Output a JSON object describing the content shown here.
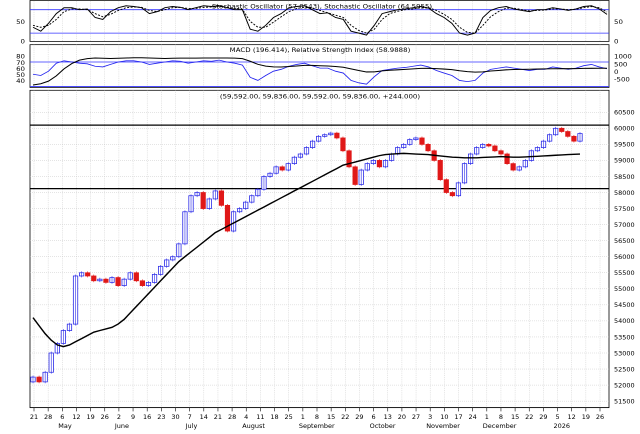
{
  "chart_data": [
    {
      "type": "line",
      "panel": "stochastic",
      "title": "Stochastic Oscillator (57.0543), Stochastic Oscillator (64.5955)",
      "ylim": [
        0,
        100
      ],
      "yticks": [
        0,
        50,
        100
      ],
      "ref_lines": [
        20,
        80
      ],
      "series": [
        {
          "name": "Stochastic %K",
          "values": [
            35,
            25,
            45,
            70,
            85,
            85,
            80,
            82,
            60,
            55,
            75,
            85,
            90,
            88,
            85,
            70,
            75,
            85,
            88,
            86,
            80,
            85,
            90,
            88,
            90,
            85,
            80,
            80,
            30,
            25,
            40,
            60,
            70,
            85,
            88,
            90,
            80,
            70,
            72,
            60,
            55,
            25,
            20,
            15,
            40,
            70,
            75,
            80,
            82,
            85,
            88,
            84,
            70,
            60,
            45,
            20,
            15,
            20,
            60,
            78,
            85,
            88,
            82,
            78,
            75,
            80,
            80,
            85,
            82,
            78,
            82,
            88,
            90,
            82,
            68
          ]
        },
        {
          "name": "Stochastic %D",
          "values": [
            40,
            35,
            40,
            55,
            75,
            82,
            82,
            80,
            70,
            62,
            68,
            78,
            85,
            87,
            86,
            78,
            75,
            80,
            85,
            86,
            83,
            83,
            86,
            87,
            88,
            87,
            83,
            81,
            50,
            35,
            35,
            48,
            62,
            75,
            83,
            86,
            84,
            78,
            72,
            66,
            60,
            40,
            27,
            20,
            30,
            55,
            70,
            76,
            80,
            82,
            85,
            85,
            78,
            68,
            55,
            35,
            22,
            20,
            40,
            62,
            75,
            84,
            84,
            80,
            77,
            78,
            79,
            82,
            82,
            80,
            81,
            85,
            88,
            85,
            74
          ]
        }
      ]
    },
    {
      "type": "line",
      "panel": "macd_rsi",
      "title": "MACD (196.414), Relative Strength Index (58.9888)",
      "ylim_left": [
        30,
        80
      ],
      "yticks_left": [
        40,
        50,
        60,
        70,
        80
      ],
      "ylim_right": [
        -1000,
        1000
      ],
      "yticks_right": [
        -500,
        0,
        500,
        1000
      ],
      "ref_lines_left": [
        30,
        70
      ],
      "series": [
        {
          "name": "RSI",
          "values": [
            50,
            48,
            55,
            68,
            72,
            70,
            68,
            67,
            63,
            62,
            66,
            70,
            72,
            72,
            70,
            66,
            68,
            70,
            72,
            71,
            68,
            70,
            72,
            71,
            73,
            70,
            68,
            65,
            45,
            40,
            48,
            55,
            58,
            63,
            66,
            68,
            64,
            60,
            60,
            55,
            52,
            40,
            36,
            34,
            46,
            56,
            58,
            60,
            61,
            63,
            65,
            62,
            56,
            52,
            48,
            40,
            38,
            40,
            52,
            58,
            60,
            62,
            60,
            58,
            56,
            58,
            58,
            62,
            60,
            58,
            60,
            64,
            66,
            62,
            59
          ]
        },
        {
          "name": "MACD",
          "values": [
            -900,
            -820,
            -650,
            -300,
            150,
            500,
            720,
            820,
            860,
            840,
            830,
            840,
            860,
            880,
            880,
            860,
            840,
            830,
            840,
            850,
            850,
            850,
            860,
            860,
            860,
            860,
            850,
            820,
            650,
            450,
            330,
            280,
            270,
            300,
            340,
            380,
            380,
            360,
            340,
            300,
            260,
            150,
            40,
            -50,
            -40,
            20,
            60,
            90,
            120,
            150,
            180,
            190,
            170,
            140,
            100,
            30,
            -30,
            -60,
            -40,
            10,
            50,
            90,
            110,
            120,
            130,
            140,
            150,
            160,
            165,
            165,
            170,
            180,
            190,
            195,
            196
          ]
        }
      ]
    },
    {
      "type": "ohlc",
      "panel": "price",
      "title": "(59,592.00, 59,836.00, 59,592.00, 59,836.00, +244.000)",
      "ylim": [
        51500,
        60750
      ],
      "yticks": [
        51500,
        52000,
        52500,
        53000,
        53500,
        54000,
        54500,
        55000,
        55500,
        56000,
        56500,
        57000,
        57500,
        58000,
        58500,
        59000,
        59500,
        60000,
        60500
      ],
      "horizontal_lines": [
        60100,
        58120
      ],
      "x_tick_labels": [
        "21",
        "28",
        "6",
        "12",
        "19",
        "26",
        "2",
        "9",
        "16",
        "23",
        "30",
        "7",
        "14",
        "21",
        "28",
        "4",
        "11",
        "18",
        "25",
        "1",
        "8",
        "15",
        "22",
        "29",
        "6",
        "13",
        "20",
        "27",
        "3",
        "10",
        "17",
        "24",
        "1",
        "8",
        "15",
        "22",
        "29",
        "5",
        "12",
        "19",
        "26"
      ],
      "month_labels": [
        "May",
        "June",
        "July",
        "August",
        "September",
        "October",
        "November",
        "December",
        "2026"
      ],
      "close": [
        52250,
        52100,
        52400,
        53000,
        53300,
        53700,
        53900,
        55400,
        55500,
        55400,
        55250,
        55300,
        55200,
        55350,
        55100,
        55300,
        55500,
        55250,
        55100,
        55200,
        55450,
        55700,
        55900,
        56000,
        56400,
        57400,
        57900,
        58000,
        57500,
        57800,
        58050,
        57600,
        56800,
        57400,
        57500,
        57700,
        57900,
        58100,
        58500,
        58600,
        58800,
        58700,
        58900,
        59100,
        59200,
        59400,
        59600,
        59750,
        59800,
        59850,
        59700,
        59300,
        58800,
        58250,
        58700,
        58900,
        59000,
        58800,
        59000,
        59200,
        59400,
        59500,
        59650,
        59700,
        59500,
        59300,
        59000,
        58400,
        58000,
        57900,
        58300,
        58900,
        59200,
        59400,
        59500,
        59450,
        59300,
        59200,
        58900,
        58700,
        58800,
        59000,
        59300,
        59400,
        59600,
        59800,
        60000,
        59900,
        59750,
        59600,
        59836
      ],
      "ma50": [
        54100,
        53850,
        53600,
        53400,
        53250,
        53200,
        53250,
        53350,
        53450,
        53550,
        53650,
        53700,
        53750,
        53800,
        53900,
        54050,
        54250,
        54450,
        54650,
        54850,
        55050,
        55250,
        55450,
        55650,
        55850,
        56000,
        56150,
        56300,
        56450,
        56600,
        56750,
        56850,
        56950,
        57050,
        57150,
        57250,
        57350,
        57450,
        57550,
        57650,
        57750,
        57850,
        57950,
        58050,
        58150,
        58250,
        58350,
        58450,
        58550,
        58650,
        58750,
        58850,
        58900,
        58950,
        59000,
        59050,
        59100,
        59150,
        59180,
        59200,
        59210,
        59220,
        59210,
        59200,
        59190,
        59180,
        59160,
        59140,
        59120,
        59100,
        59090,
        59080,
        59080,
        59080,
        59090,
        59100,
        59110,
        59120,
        59110,
        59100,
        59100,
        59110,
        59120,
        59130,
        59140,
        59150,
        59160,
        59170,
        59180,
        59190,
        59200
      ]
    }
  ]
}
